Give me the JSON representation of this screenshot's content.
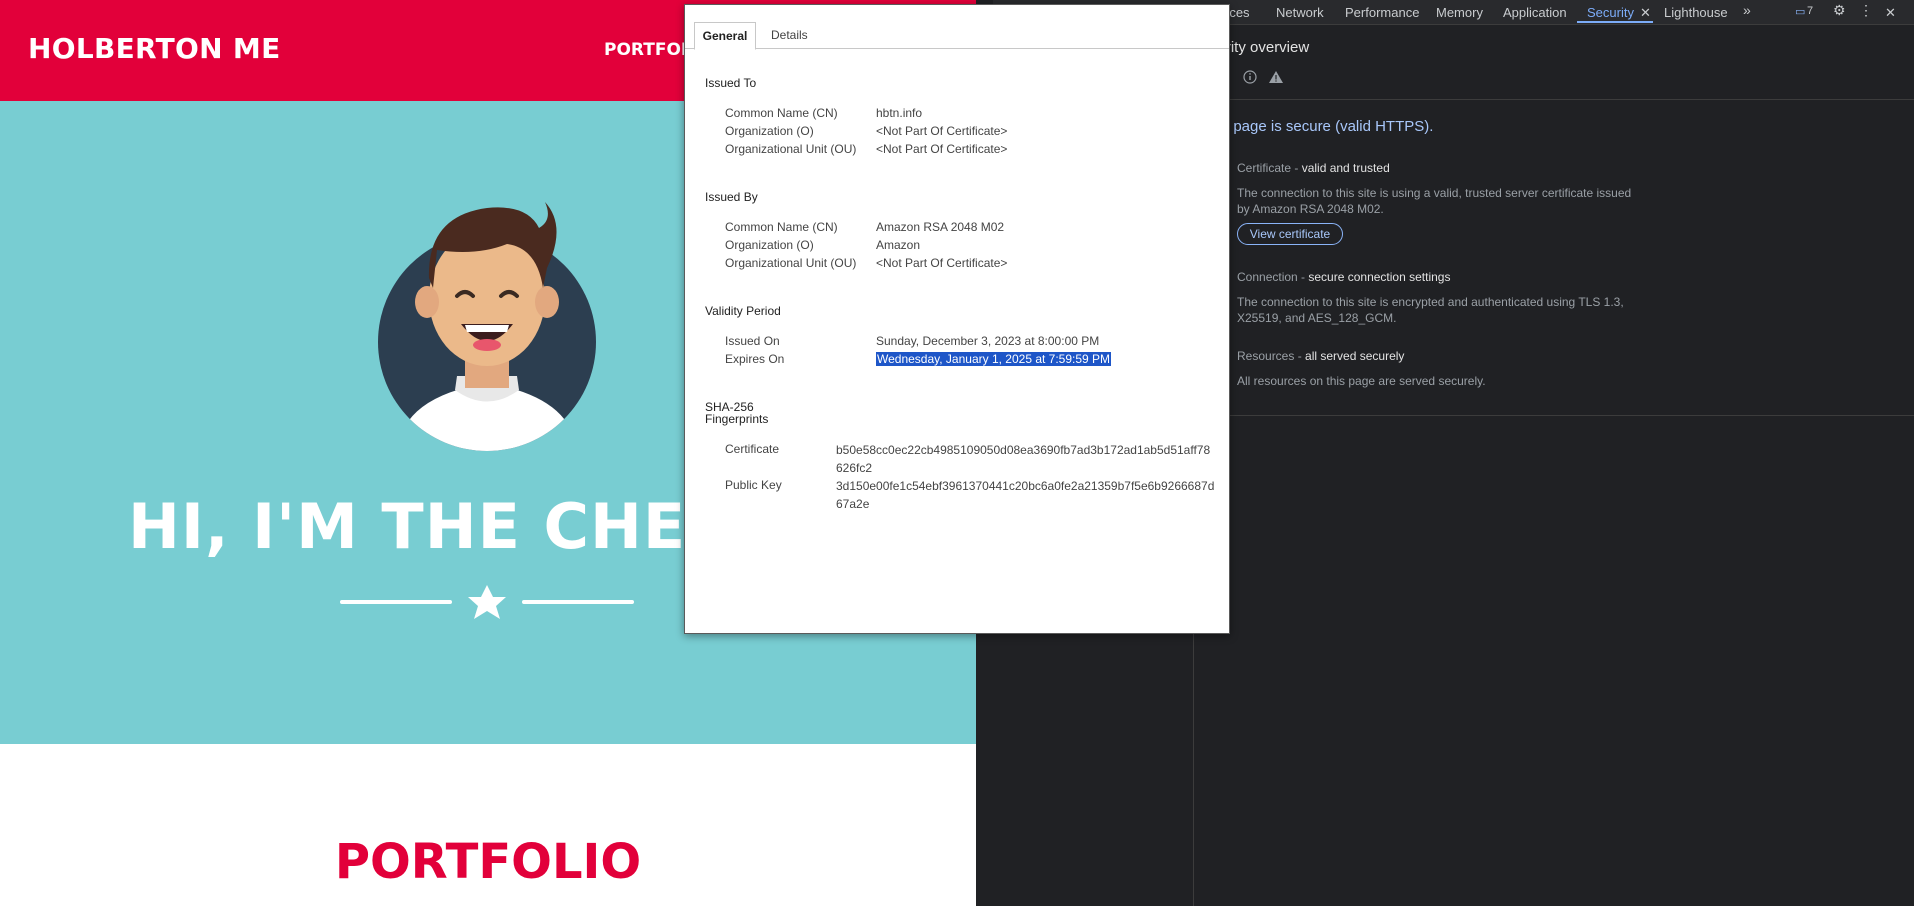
{
  "site": {
    "logo": "HOLBERTON ME",
    "nav_item": "PORTFOL",
    "hero_title": "HI, I'M THE CHEC",
    "portfolio_title": "PORTFOLIO",
    "colors": {
      "brand_red": "#e2003a",
      "hero_teal": "#78cdd2"
    }
  },
  "devtools": {
    "tabs": [
      {
        "label": "rces"
      },
      {
        "label": "Network"
      },
      {
        "label": "Performance"
      },
      {
        "label": "Memory"
      },
      {
        "label": "Application"
      },
      {
        "label": "Security",
        "active": true
      },
      {
        "label": "Lighthouse"
      }
    ],
    "more_tabs_icon": "»",
    "issues_count": "7",
    "security": {
      "heading": "curity overview",
      "summary": "his page is secure (valid HTTPS).",
      "certificate_label": "Certificate - ",
      "certificate_status": "valid and trusted",
      "certificate_desc": "The connection to this site is using a valid, trusted server certificate issued by Amazon RSA 2048 M02.",
      "view_certificate": "View certificate",
      "connection_label": "Connection - ",
      "connection_status": "secure connection settings",
      "connection_desc": "The connection to this site is encrypted and authenticated using TLS 1.3, X25519, and AES_128_GCM.",
      "resources_label": "Resources - ",
      "resources_status": "all served securely",
      "resources_desc": "All resources on this page are served securely."
    }
  },
  "certificate": {
    "tabs": {
      "general": "General",
      "details": "Details"
    },
    "issued_to": {
      "title": "Issued To",
      "cn_label": "Common Name (CN)",
      "cn": "hbtn.info",
      "o_label": "Organization (O)",
      "o": "<Not Part Of Certificate>",
      "ou_label": "Organizational Unit (OU)",
      "ou": "<Not Part Of Certificate>"
    },
    "issued_by": {
      "title": "Issued By",
      "cn_label": "Common Name (CN)",
      "cn": "Amazon RSA 2048 M02",
      "o_label": "Organization (O)",
      "o": "Amazon",
      "ou_label": "Organizational Unit (OU)",
      "ou": "<Not Part Of Certificate>"
    },
    "validity": {
      "title": "Validity Period",
      "issued_label": "Issued On",
      "issued": "Sunday, December 3, 2023 at 8:00:00 PM",
      "expires_label": "Expires On",
      "expires": "Wednesday, January 1, 2025 at 7:59:59 PM"
    },
    "fingerprints": {
      "title_line1": "SHA-256",
      "title_line2": "Fingerprints",
      "cert_label": "Certificate",
      "cert": "b50e58cc0ec22cb4985109050d08ea3690fb7ad3b172ad1ab5d51aff78626fc2",
      "pk_label": "Public Key",
      "pk": "3d150e00fe1c54ebf3961370441c20bc6a0fe2a21359b7f5e6b9266687d67a2e"
    }
  }
}
